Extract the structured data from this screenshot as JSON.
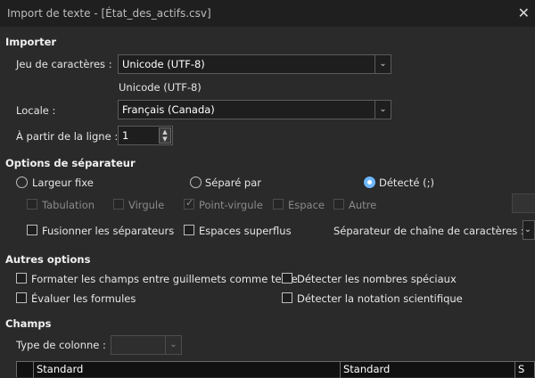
{
  "window": {
    "title": "Import de texte - [État_des_actifs.csv]",
    "close_glyph": "✕"
  },
  "importer": {
    "heading": "Importer",
    "charset_label": "Jeu de caractères :",
    "charset_value": "Unicode (UTF-8)",
    "charset_preview": "Unicode (UTF-8)",
    "locale_label": "Locale :",
    "locale_value": "Français (Canada)",
    "from_line_label": "À partir de la ligne :",
    "from_line_value": "1"
  },
  "separator": {
    "heading": "Options de séparateur",
    "radios": [
      {
        "label": "Largeur fixe",
        "selected": false
      },
      {
        "label": "Séparé par",
        "selected": false
      },
      {
        "label": "Détecté (;)",
        "selected": true
      }
    ],
    "checks": [
      {
        "label": "Tabulation",
        "checked": false
      },
      {
        "label": "Virgule",
        "checked": false
      },
      {
        "label": "Point-virgule",
        "checked": true
      },
      {
        "label": "Espace",
        "checked": false
      },
      {
        "label": "Autre",
        "checked": false
      }
    ],
    "merge_label": "Fusionner les séparateurs",
    "trim_label": "Espaces superflus",
    "string_delim_label": "Séparateur de chaîne de caractères :"
  },
  "other": {
    "heading": "Autres options",
    "options": [
      "Formater les champs entre guillemets comme texte",
      "Détecter les nombres spéciaux",
      "Évaluer les formules",
      "Détecter la notation scientifique"
    ]
  },
  "fields": {
    "heading": "Champs",
    "column_type_label": "Type de colonne :",
    "columns": [
      "Standard",
      "Standard",
      "S"
    ]
  }
}
